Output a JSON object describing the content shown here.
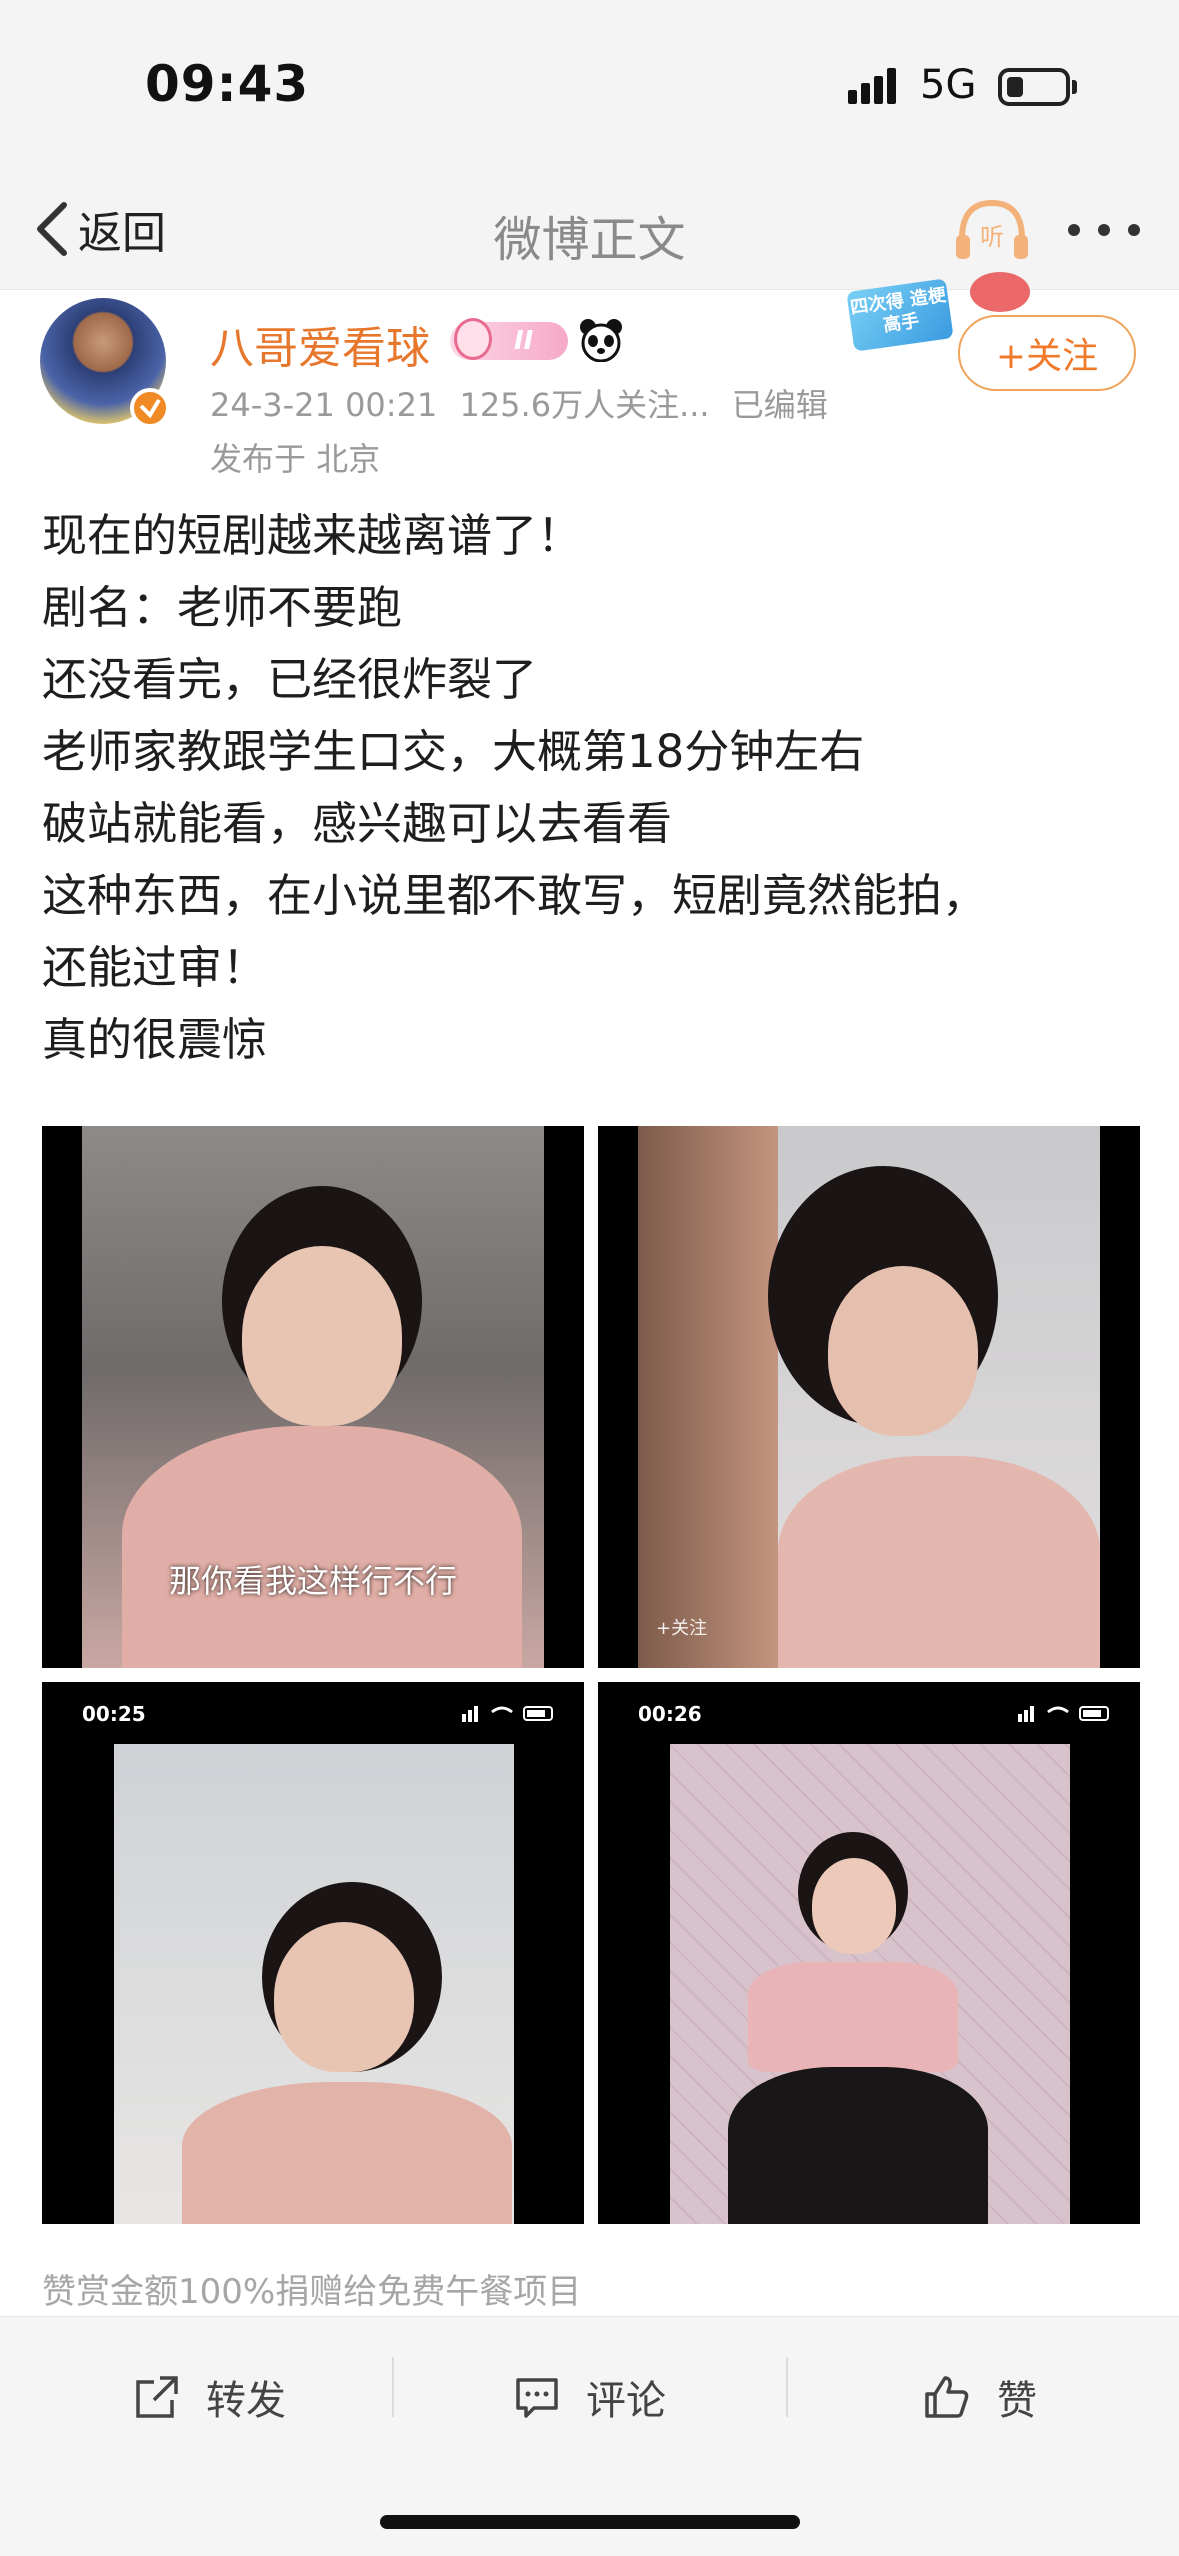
{
  "status_bar": {
    "time": "09:43",
    "network": "5G"
  },
  "nav": {
    "back_label": "返回",
    "title": "微博正文",
    "listen_label": "听"
  },
  "author": {
    "name": "八哥爱看球",
    "vip_level": "II",
    "timestamp": "24-3-21 00:21",
    "followers": "125.6万人关注...",
    "edited": "已编辑",
    "location": "发布于 北京",
    "follow_label": "+关注",
    "promo_text": "四次得 造梗高手"
  },
  "post": {
    "lines": [
      "现在的短剧越来越离谱了！",
      "剧名：老师不要跑",
      "还没看完，已经很炸裂了",
      "老师家教跟学生口交，大概第18分钟左右",
      "破站就能看，感兴趣可以去看看",
      "这种东西，在小说里都不敢写，短剧竟然能拍，",
      "还能过审！",
      "真的很震惊"
    ]
  },
  "images": {
    "caption_1": "那你看我这样行不行",
    "follow_tag_2": "+关注",
    "time_3": "00:25",
    "time_4": "00:26"
  },
  "reward_text": "赞赏金额100%捐赠给免费午餐项目",
  "actions": {
    "repost": "转发",
    "comment": "评论",
    "like": "赞"
  },
  "colors": {
    "accent": "#e8772e",
    "follow_border": "#f0a35a",
    "meta_gray": "#9a9a9a"
  }
}
